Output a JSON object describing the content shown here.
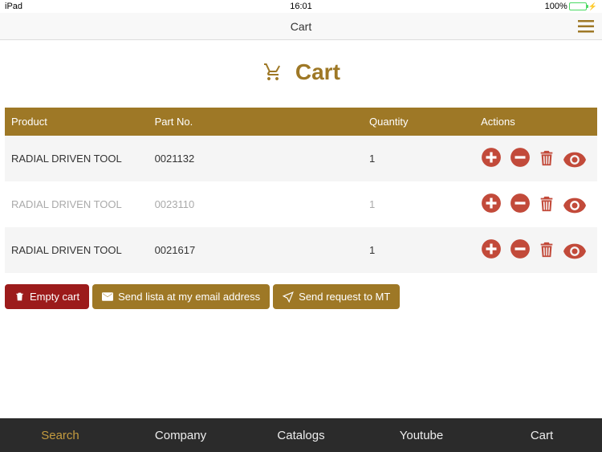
{
  "status": {
    "device": "iPad",
    "time": "16:01",
    "battery": "100%"
  },
  "nav": {
    "title": "Cart"
  },
  "page": {
    "title": "Cart"
  },
  "table": {
    "headers": {
      "product": "Product",
      "partno": "Part No.",
      "quantity": "Quantity",
      "actions": "Actions"
    },
    "rows": [
      {
        "product": "RADIAL DRIVEN TOOL",
        "partno": "0021132",
        "quantity": "1"
      },
      {
        "product": "RADIAL DRIVEN TOOL",
        "partno": "0023110",
        "quantity": "1"
      },
      {
        "product": "RADIAL DRIVEN TOOL",
        "partno": "0021617",
        "quantity": "1"
      }
    ]
  },
  "buttons": {
    "empty": "Empty cart",
    "send_email": "Send lista at my email address",
    "send_mt": "Send request to MT"
  },
  "tabs": {
    "search": "Search",
    "company": "Company",
    "catalogs": "Catalogs",
    "youtube": "Youtube",
    "cart": "Cart"
  }
}
